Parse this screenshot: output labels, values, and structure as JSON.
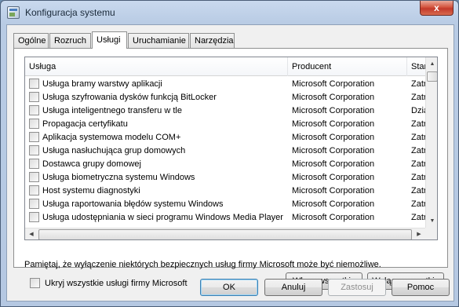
{
  "window": {
    "title": "Konfiguracja systemu",
    "close_glyph": "x"
  },
  "tabs": [
    {
      "label": "Ogólne"
    },
    {
      "label": "Rozruch"
    },
    {
      "label": "Usługi"
    },
    {
      "label": "Uruchamianie"
    },
    {
      "label": "Narzędzia"
    }
  ],
  "active_tab": "Usługi",
  "services": {
    "columns": {
      "service": "Usługa",
      "manufacturer": "Producent",
      "status": "Stan"
    },
    "rows": [
      {
        "name": "Usługa bramy warstwy aplikacji",
        "manufacturer": "Microsoft Corporation",
        "status": "Zatrzymana"
      },
      {
        "name": "Usługa szyfrowania dysków funkcją BitLocker",
        "manufacturer": "Microsoft Corporation",
        "status": "Zatrzymana"
      },
      {
        "name": "Usługa inteligentnego transferu w tle",
        "manufacturer": "Microsoft Corporation",
        "status": "Działa"
      },
      {
        "name": "Propagacja certyfikatu",
        "manufacturer": "Microsoft Corporation",
        "status": "Zatrzymana"
      },
      {
        "name": "Aplikacja systemowa modelu COM+",
        "manufacturer": "Microsoft Corporation",
        "status": "Zatrzymana"
      },
      {
        "name": "Usługa nasłuchująca grup domowych",
        "manufacturer": "Microsoft Corporation",
        "status": "Zatrzymana"
      },
      {
        "name": "Dostawca grupy domowej",
        "manufacturer": "Microsoft Corporation",
        "status": "Zatrzymana"
      },
      {
        "name": "Usługa biometryczna systemu Windows",
        "manufacturer": "Microsoft Corporation",
        "status": "Zatrzymana"
      },
      {
        "name": "Host systemu diagnostyki",
        "manufacturer": "Microsoft Corporation",
        "status": "Zatrzymana"
      },
      {
        "name": "Usługa raportowania błędów systemu Windows",
        "manufacturer": "Microsoft Corporation",
        "status": "Zatrzymana"
      },
      {
        "name": "Usługa udostępniania w sieci programu Windows Media Player",
        "manufacturer": "Microsoft Corporation",
        "status": "Zatrzymana"
      }
    ]
  },
  "note": "Pamiętaj, że wyłączenie niektórych bezpiecznych usług firmy Microsoft może być niemożliwe.",
  "hide_ms": {
    "label": "Ukryj wszystkie usługi firmy Microsoft"
  },
  "buttons": {
    "enable_all": "Włącz wszystkie",
    "disable_all": "Wyłącz wszystkie",
    "ok": "OK",
    "cancel": "Anuluj",
    "apply": "Zastosuj",
    "help": "Pomoc"
  }
}
